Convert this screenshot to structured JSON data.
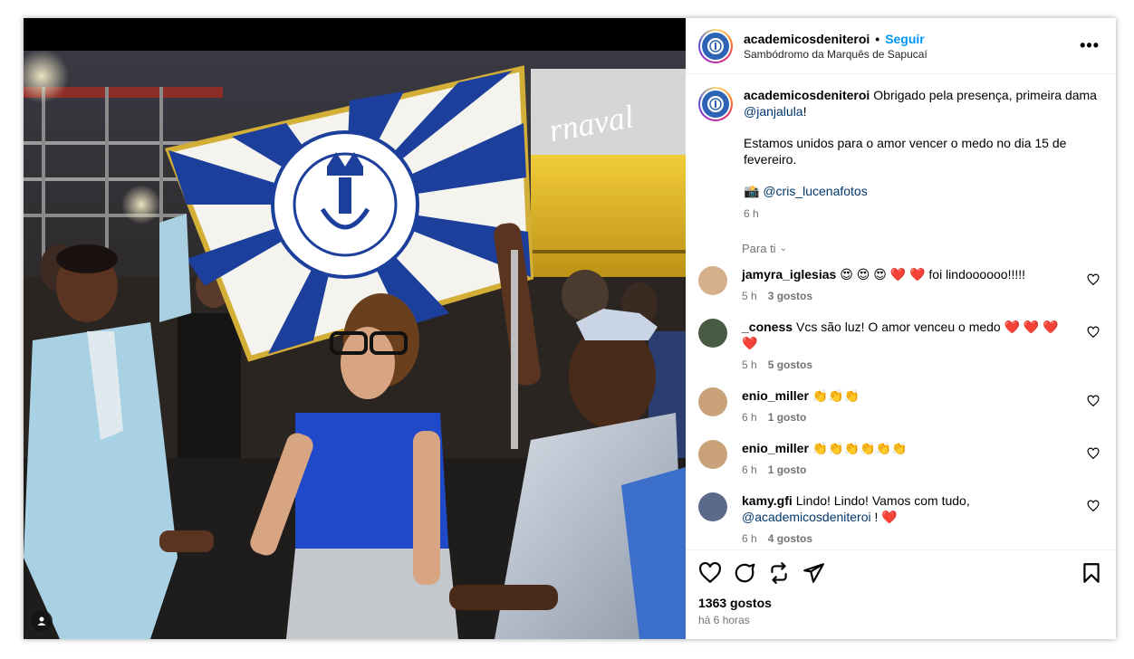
{
  "post": {
    "username": "academicosdeniteroi",
    "dot": "•",
    "follow_label": "Seguir",
    "location": "Sambódromo da Marquês de Sapucaí",
    "more_label": "•••"
  },
  "caption": {
    "username": "academicosdeniteroi",
    "line1": "Obrigado pela presença, primeira dama",
    "mention1": "@janjalula",
    "line1_end": "!",
    "line2": "Estamos unidos para o amor vencer o medo no dia 15 de fevereiro.",
    "camera_emoji": "📸",
    "mention2": "@cris_lucenafotos",
    "time": "6 h"
  },
  "filter": {
    "label": "Para ti",
    "chevron": "⌄"
  },
  "comments": [
    {
      "user": "jamyra_iglesias",
      "text": "😍 😍 😍 ❤️ ❤️ foi lindoooooo!!!!!",
      "time": "5 h",
      "likes": "3 gostos"
    },
    {
      "user": "_coness",
      "text": "Vcs são luz! O amor venceu o medo ❤️ ❤️ ❤️ ❤️",
      "time": "5 h",
      "likes": "5 gostos"
    },
    {
      "user": "enio_miller",
      "text": "👏👏👏",
      "time": "6 h",
      "likes": "1 gosto"
    },
    {
      "user": "enio_miller",
      "text": "👏👏👏👏👏👏",
      "time": "6 h",
      "likes": "1 gosto"
    },
    {
      "user": "kamy.gfi",
      "text": "Lindo! Lindo! Vamos com tudo,",
      "mention": "@academicosdeniteroi",
      "text_end": "! ❤️",
      "time": "6 h",
      "likes": "4 gostos"
    }
  ],
  "footer": {
    "likes": "1363 gostos",
    "ago": "há 6 horas"
  },
  "colors": {
    "accent": "#0095f6",
    "mention": "#00376b",
    "secondary_text": "#737373",
    "flag_blue": "#1d3f9c"
  },
  "icons": {
    "like": "heart-icon",
    "comment": "comment-icon",
    "share": "repost-icon",
    "send": "send-icon",
    "save": "bookmark-icon",
    "tag": "user-tag-icon"
  }
}
